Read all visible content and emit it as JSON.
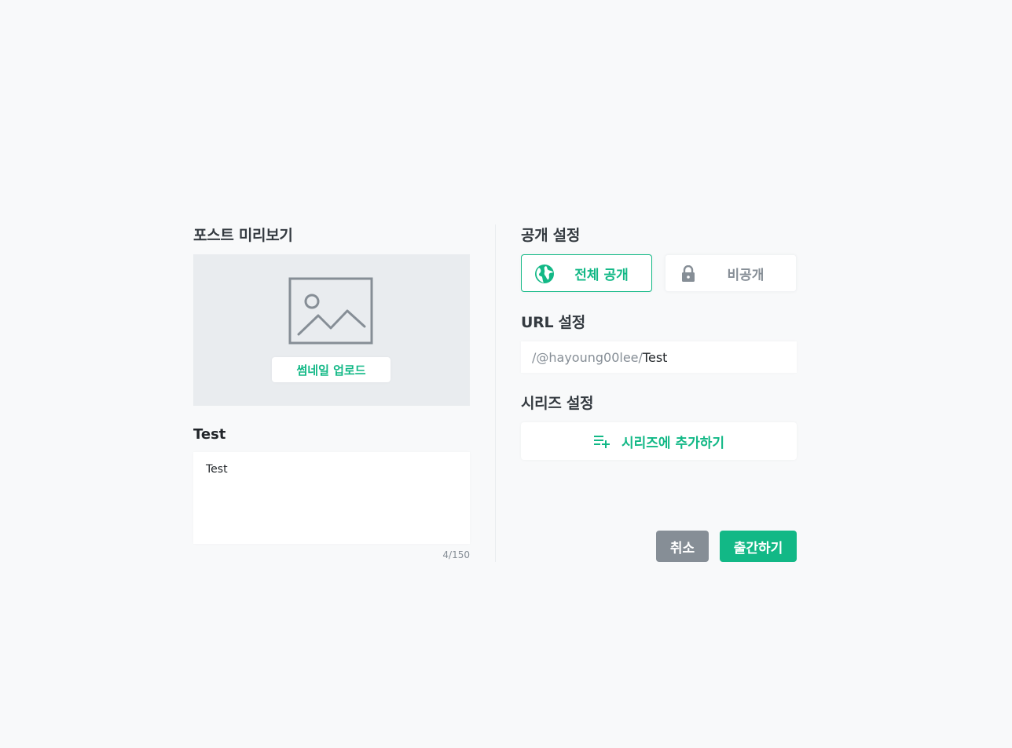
{
  "preview": {
    "section_title": "포스트 미리보기",
    "thumbnail_icon": "image-placeholder-icon",
    "upload_label": "썸네일 업로드",
    "post_title": "Test",
    "description": "Test",
    "counter": "4/150"
  },
  "visibility": {
    "section_title": "공개 설정",
    "public_label": "전체 공개",
    "public_icon": "globe-icon",
    "private_label": "비공개",
    "private_icon": "lock-icon",
    "selected": "public"
  },
  "url": {
    "section_title": "URL 설정",
    "prefix": "/@hayoung00lee/",
    "slug": "Test"
  },
  "series": {
    "section_title": "시리즈 설정",
    "add_label": "시리즈에 추가하기",
    "add_icon": "playlist-add-icon"
  },
  "actions": {
    "cancel_label": "취소",
    "publish_label": "출간하기"
  },
  "colors": {
    "accent": "#12b886",
    "muted": "#868e96",
    "background": "#f8f9fa"
  }
}
